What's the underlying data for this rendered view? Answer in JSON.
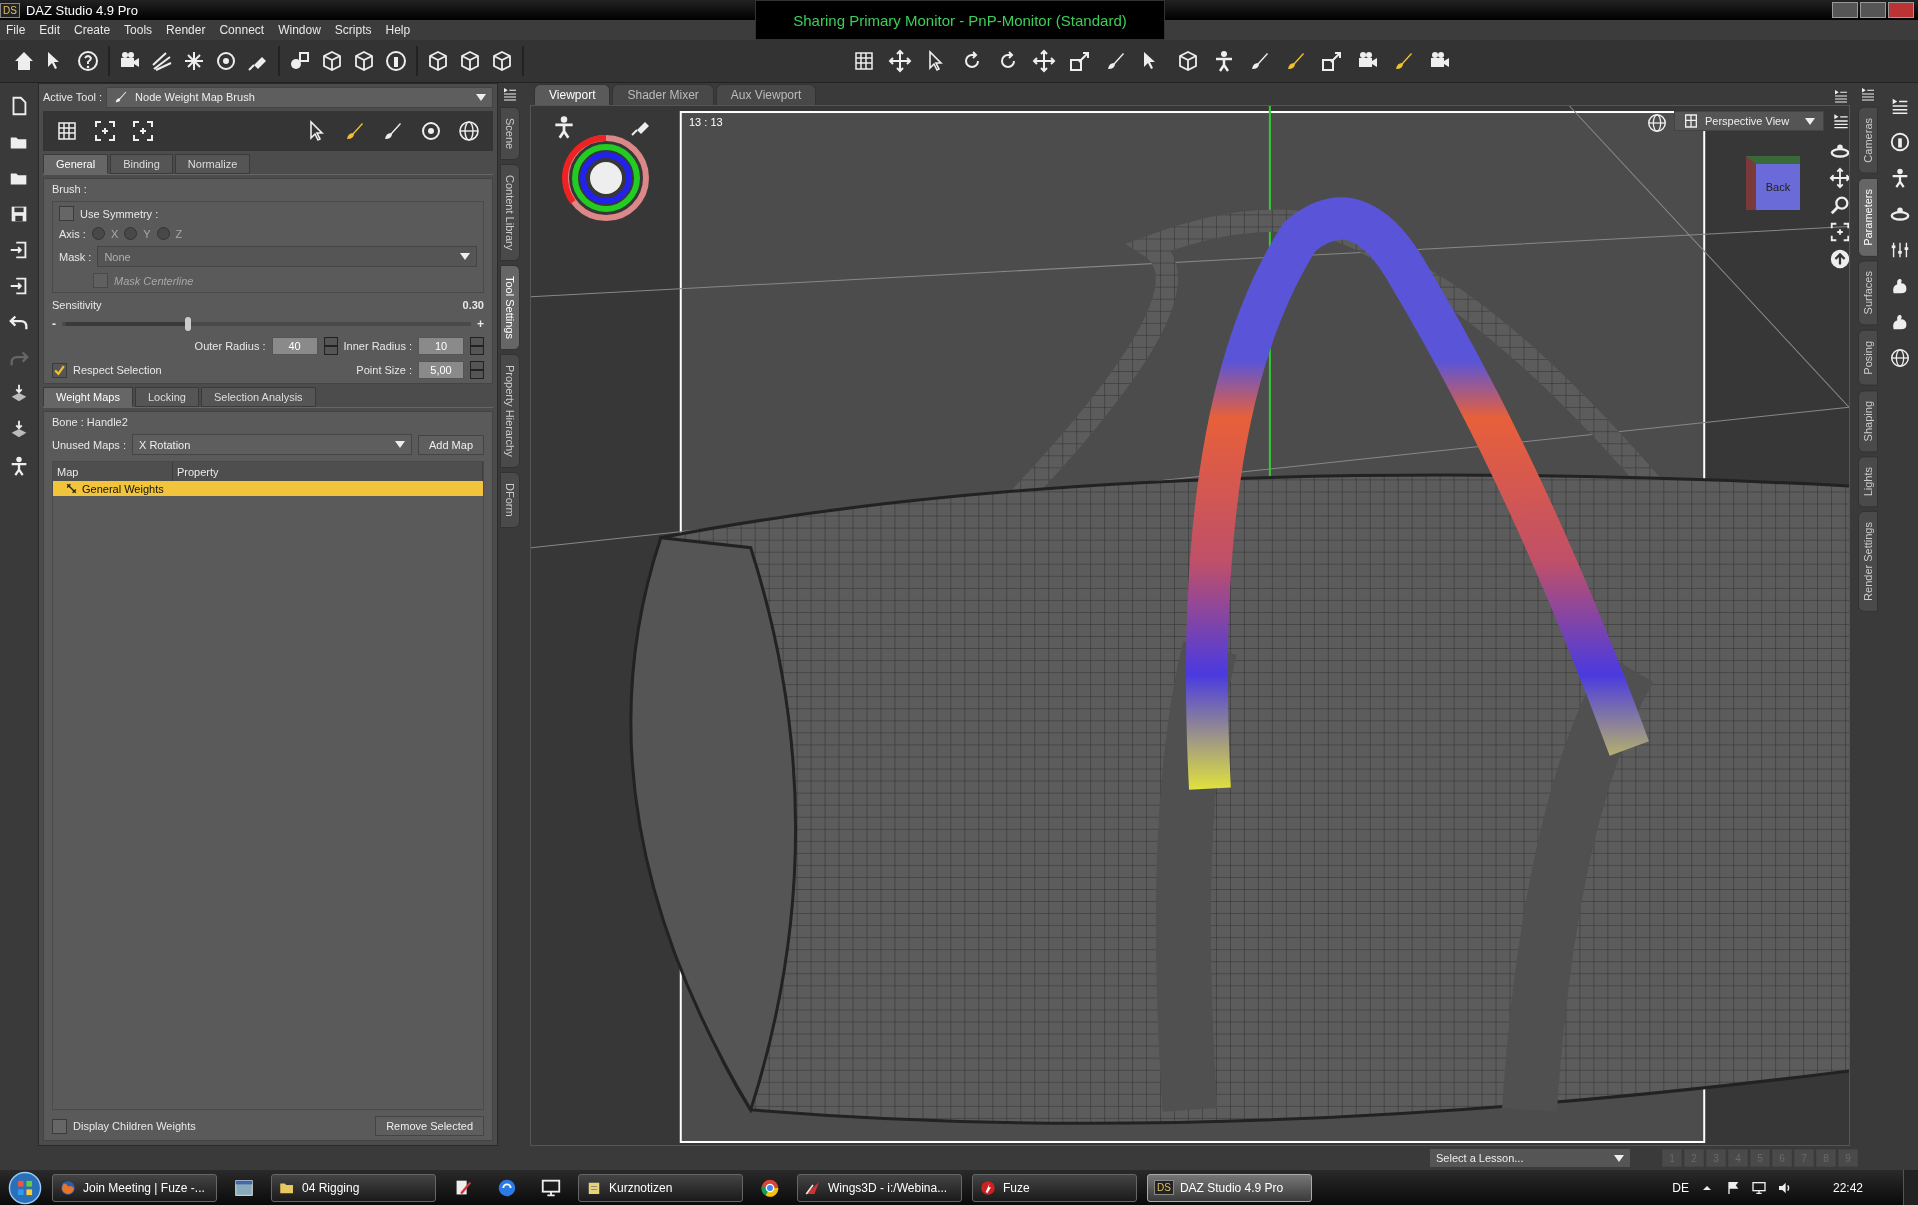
{
  "window": {
    "logo": "DS",
    "title": "DAZ Studio 4.9 Pro"
  },
  "sharing_banner": "Sharing Primary Monitor - PnP-Monitor (Standard)",
  "menu": [
    "File",
    "Edit",
    "Create",
    "Tools",
    "Render",
    "Connect",
    "Window",
    "Scripts",
    "Help"
  ],
  "active_tool": {
    "label": "Active Tool :",
    "value": "Node Weight Map Brush"
  },
  "tool_tabs": [
    {
      "label": "General",
      "selected": true
    },
    {
      "label": "Binding",
      "selected": false
    },
    {
      "label": "Normalize",
      "selected": false
    }
  ],
  "brush": {
    "label": "Brush :",
    "use_symmetry": {
      "label": "Use Symmetry :",
      "checked": false
    },
    "axis": {
      "label": "Axis :",
      "disabled": true,
      "options": [
        {
          "label": "X",
          "selected": false
        },
        {
          "label": "Y",
          "selected": false
        },
        {
          "label": "Z",
          "selected": false
        }
      ]
    },
    "mask": {
      "label": "Mask :",
      "value": "None",
      "disabled": true
    },
    "mask_centerline": {
      "label": "Mask Centerline",
      "checked": false,
      "disabled": true
    }
  },
  "sensitivity": {
    "label": "Sensitivity",
    "reading": "0.30",
    "minus": "-",
    "plus": "+",
    "level": 0.3
  },
  "radius": [
    {
      "label": "Outer Radius :",
      "value": "40"
    },
    {
      "label": "Inner Radius :",
      "value": "10"
    }
  ],
  "point_size": {
    "label": "Point Size :",
    "value": "5,00"
  },
  "respect_selection": {
    "label": "Respect Selection",
    "checked": true
  },
  "map_tabs": [
    {
      "label": "Weight Maps",
      "selected": true
    },
    {
      "label": "Locking",
      "selected": false
    },
    {
      "label": "Selection Analysis",
      "selected": false
    }
  ],
  "bone": "Bone : Handle2",
  "unused_maps": {
    "label": "Unused Maps :",
    "value": "X Rotation",
    "button": "Add Map"
  },
  "map_table": {
    "columns": [
      "Map",
      "Property"
    ],
    "rows": [
      {
        "map": "General Weights",
        "selected": true
      }
    ]
  },
  "display_children": {
    "label": "Display Children Weights",
    "checked": false
  },
  "remove_button": "Remove Selected",
  "left_dock_tabs": [
    {
      "label": "Scene",
      "selected": false
    },
    {
      "label": "Content Library",
      "selected": false
    },
    {
      "label": "Tool Settings",
      "selected": true
    },
    {
      "label": "Property Hierarchy",
      "selected": false
    },
    {
      "label": "DForm",
      "selected": false
    }
  ],
  "viewport_tabs": [
    {
      "label": "Viewport",
      "selected": true
    },
    {
      "label": "Shader Mixer",
      "selected": false
    },
    {
      "label": "Aux Viewport",
      "selected": false
    }
  ],
  "viewport": {
    "frame_label": "13 : 13",
    "view": "Perspective View",
    "cube_label": "Back"
  },
  "right_dock_tabs": [
    {
      "label": "Cameras",
      "selected": false
    },
    {
      "label": "Parameters",
      "selected": true
    },
    {
      "label": "Surfaces",
      "selected": false
    },
    {
      "label": "Posing",
      "selected": false
    },
    {
      "label": "Shaping",
      "selected": false
    },
    {
      "label": "Lights",
      "selected": false
    },
    {
      "label": "Render Settings",
      "selected": false
    }
  ],
  "lesson": {
    "placeholder": "Select a Lesson...",
    "steps": [
      "1",
      "2",
      "3",
      "4",
      "5",
      "6",
      "7",
      "8",
      "9"
    ]
  },
  "taskbar": {
    "items": [
      {
        "kind": "window",
        "label": "Join Meeting | Fuze -...",
        "selected": false
      },
      {
        "kind": "icon",
        "selected": false
      },
      {
        "kind": "window",
        "label": "04 Rigging",
        "selected": false
      },
      {
        "kind": "icon",
        "selected": false
      },
      {
        "kind": "icon",
        "selected": false
      },
      {
        "kind": "icon",
        "selected": false
      },
      {
        "kind": "window",
        "label": "Kurznotizen",
        "selected": false
      },
      {
        "kind": "icon",
        "selected": false
      },
      {
        "kind": "window",
        "label": "Wings3D - i:/Webina...",
        "selected": false
      },
      {
        "kind": "window",
        "label": "Fuze",
        "selected": false
      },
      {
        "kind": "window",
        "label": "DAZ Studio 4.9 Pro",
        "logo": "DS",
        "selected": true
      }
    ],
    "language": "DE",
    "clock": "22:42"
  }
}
